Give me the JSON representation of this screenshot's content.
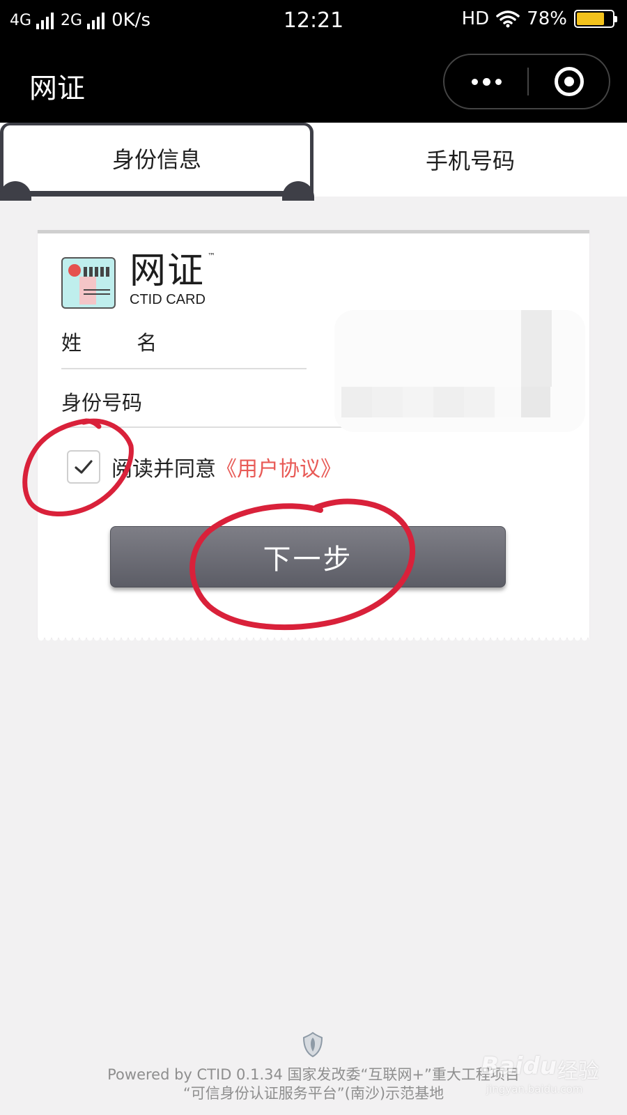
{
  "status_bar": {
    "net1": "4G",
    "net2": "2G",
    "speed": "0K/s",
    "time": "12:21",
    "hd": "HD",
    "battery": "78%",
    "battery_level": 0.78
  },
  "titlebar": {
    "title": "网证"
  },
  "tabs": [
    {
      "label": "身份信息",
      "active": true
    },
    {
      "label": "手机号码",
      "active": false
    }
  ],
  "card": {
    "brand": "网证",
    "trademark": "™",
    "brand_sub": "CTID CARD",
    "name_label": "姓 名",
    "id_label": "身份号码",
    "agree_text": "阅读并同意",
    "agree_link": "《用户协议》",
    "agree_checked": true,
    "next_button": "下一步"
  },
  "footer": {
    "line1": "Powered by CTID 0.1.34 国家发改委“互联网+”重大工程项目",
    "line2": "“可信身份认证服务平台”(南沙)示范基地"
  },
  "watermark": {
    "logo": "Baidu",
    "cn": "经验",
    "url": "jingyan.baidu.com"
  },
  "colors": {
    "accent_link": "#e85a56",
    "button": "#65666e",
    "annotation": "#d9213a"
  }
}
